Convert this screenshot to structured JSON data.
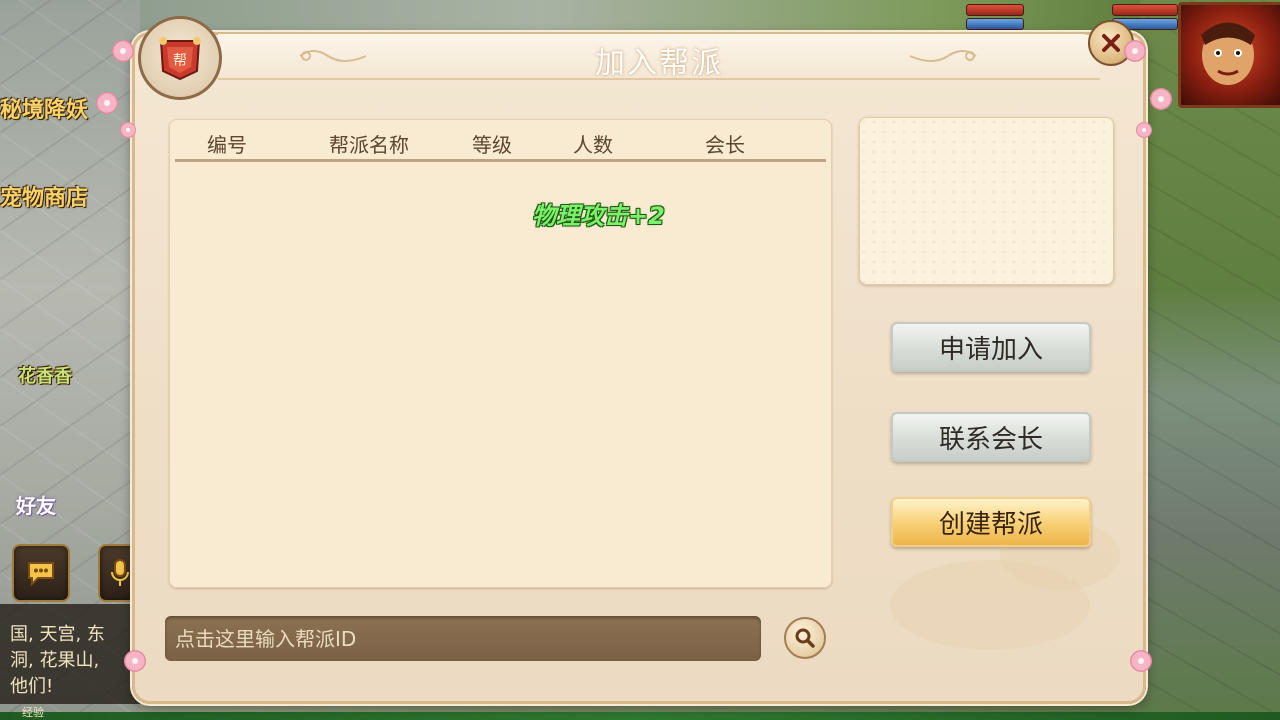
{
  "background": {
    "npc_labels": [
      "秘境降妖",
      "宠物商店",
      "花香香",
      "好友"
    ],
    "chat_lines": [
      "国, 天宫, 东",
      "洞, 花果山,",
      "他们!"
    ],
    "exp_label": "经验"
  },
  "dialog": {
    "title": "加入帮派",
    "table": {
      "columns": [
        "编号",
        "帮派名称",
        "等级",
        "人数",
        "会长"
      ],
      "rows": []
    },
    "buff_popup": "物理攻击+2",
    "buttons": {
      "apply": "申请加入",
      "contact": "联系会长",
      "create": "创建帮派"
    },
    "search": {
      "placeholder": "点击这里输入帮派ID",
      "value": ""
    }
  },
  "colors": {
    "panel_bg": "#f4e7d3",
    "accent_gold": "#eeb54a",
    "buff_green": "#7cf06b"
  },
  "icons": [
    "close-icon",
    "search-icon",
    "guild-banner-icon",
    "chat-icon",
    "microphone-icon"
  ]
}
